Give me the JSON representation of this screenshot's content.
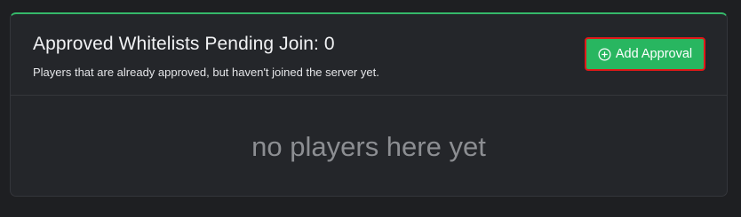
{
  "card": {
    "title": "Approved Whitelists Pending Join: 0",
    "subtitle": "Players that are already approved, but haven't joined the server yet.",
    "add_button": {
      "label": "Add Approval",
      "icon": "plus-circle-icon"
    },
    "empty_message": "no players here yet"
  },
  "colors": {
    "accent_top_border": "#35b86a",
    "button_background": "#28b660",
    "button_highlight_border": "#e01818",
    "card_background": "#24262a",
    "page_background": "#1e1f22"
  }
}
